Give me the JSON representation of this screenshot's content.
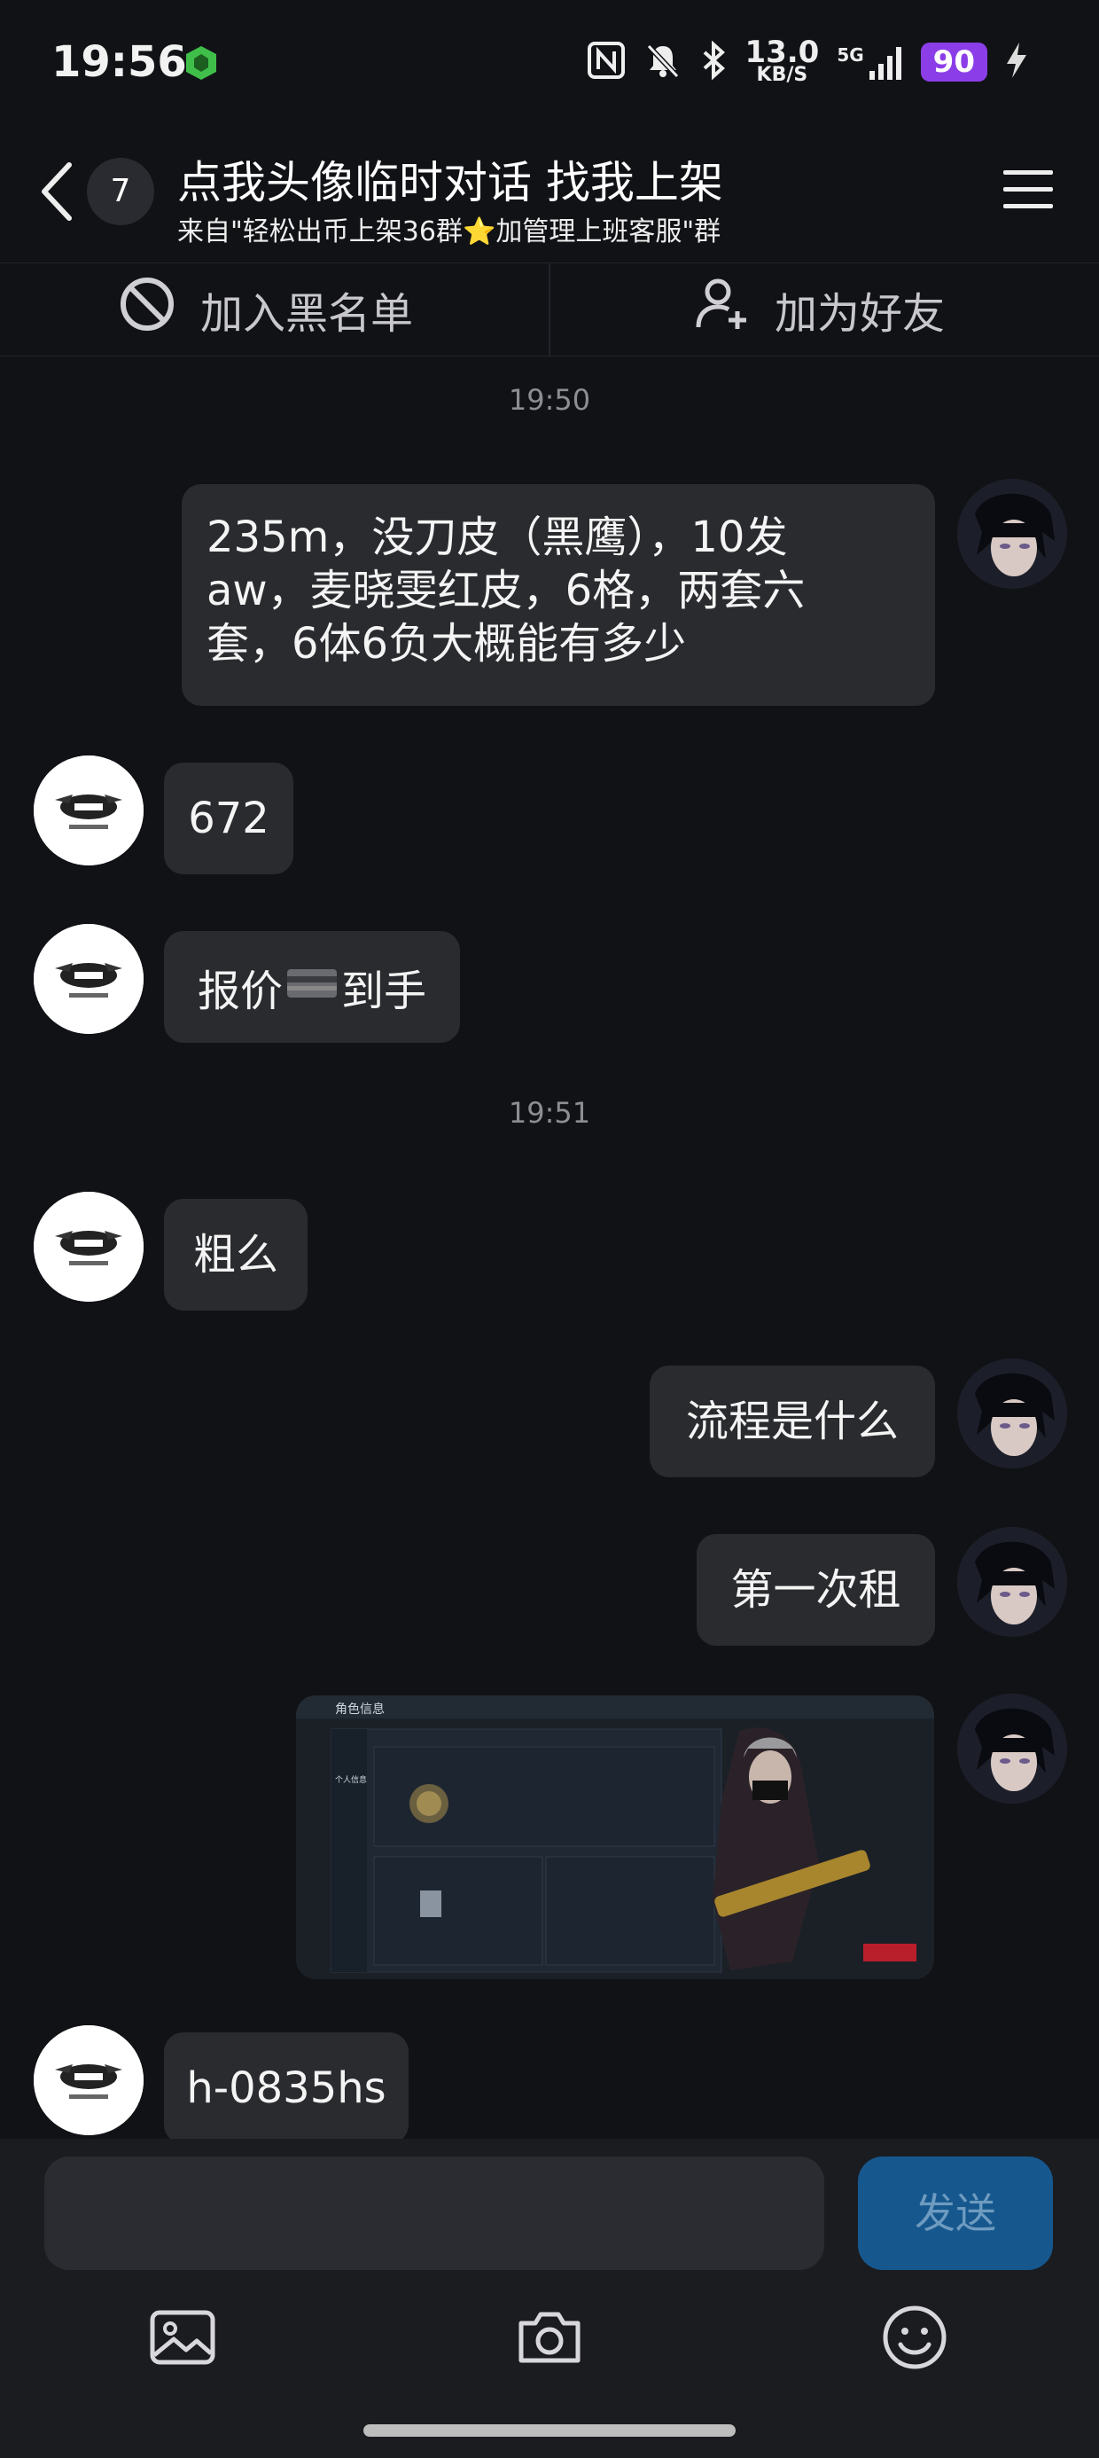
{
  "status_bar": {
    "time": "19:56",
    "net_speed_value": "13.0",
    "net_speed_unit": "KB/S",
    "network": "5G",
    "battery": "90"
  },
  "header": {
    "unread_count": "7",
    "title": "点我头像临时对话 找我上架",
    "subtitle": "来自\"轻松出币上架36群⭐加管理上班客服\"群"
  },
  "actions": {
    "block_label": "加入黑名单",
    "add_friend_label": "加为好友"
  },
  "messages": {
    "ts1": "19:50",
    "m1_line1": "235m，没刀皮（黑鹰），10发",
    "m1_line2": "aw，麦晓雯红皮，6格，两套六",
    "m1_line3": "套，6体6负大概能有多少",
    "m2": "672",
    "m3_pre": "报价",
    "m3_post": "到手",
    "ts2": "19:51",
    "m4": "粗么",
    "m5": "流程是什么",
    "m6": "第一次租",
    "m7_image_header": "角色信息",
    "m7_image_tab": "个人信息",
    "m8": "h-0835hs"
  },
  "input": {
    "send_label": "发送"
  },
  "icons": {
    "back": "chevron-left-icon",
    "menu": "hamburger-menu-icon",
    "block": "block-circle-icon",
    "add_friend": "add-user-icon",
    "gallery": "image-icon",
    "camera": "camera-icon",
    "emoji": "emoji-icon"
  },
  "colors": {
    "background": "#111216",
    "bubble": "#2a2b2f",
    "send_button": "#16588e",
    "battery": "#8b3ee8"
  }
}
